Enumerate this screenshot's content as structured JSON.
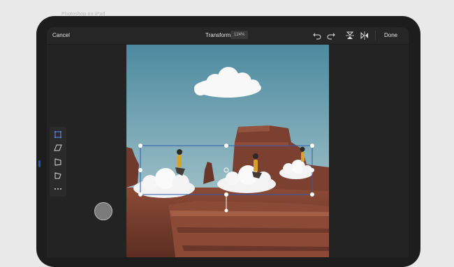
{
  "window": {
    "top_label": "Photoshop on iPad"
  },
  "toolbar": {
    "cancel_label": "Cancel",
    "title": "Transform",
    "zoom_level": "124%",
    "done_label": "Done",
    "icons": [
      "undo-icon",
      "redo-icon",
      "flip-vertical-icon",
      "flip-horizontal-icon"
    ]
  },
  "tools": [
    "rectangle-select-icon",
    "distort-icon",
    "perspective-icon",
    "warp-icon",
    "more-icon"
  ],
  "colors": {
    "sky_top": "#4c8aa0",
    "sky_bottom": "#b7cfd3",
    "rock": "#7a3f2e",
    "accent_handle": "#ffffff"
  }
}
